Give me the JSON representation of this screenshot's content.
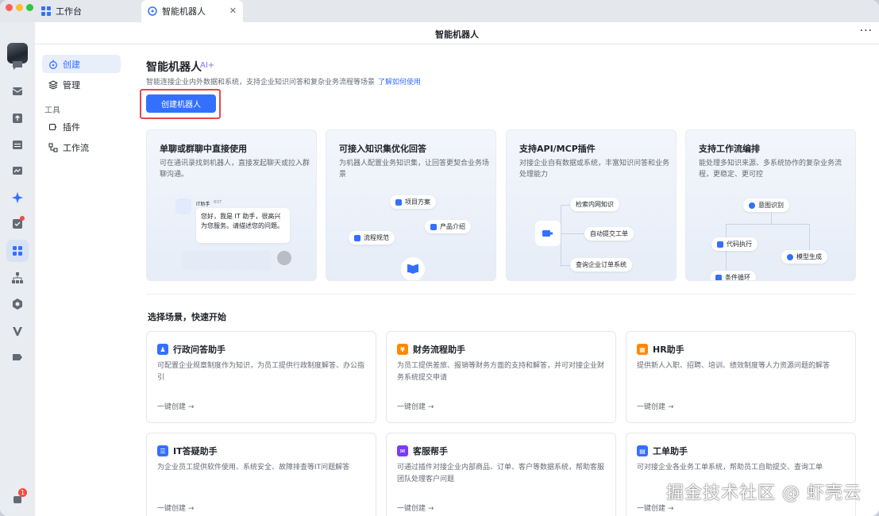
{
  "tabs": [
    {
      "label": "工作台"
    },
    {
      "label": "智能机器人"
    }
  ],
  "header": {
    "title": "智能机器人"
  },
  "subnav": {
    "items": [
      {
        "label": "创建",
        "icon": "bot-icon",
        "active": true
      },
      {
        "label": "管理",
        "icon": "layers-icon"
      }
    ],
    "group_label": "工具",
    "tool_items": [
      {
        "label": "插件",
        "icon": "plugin-icon"
      },
      {
        "label": "工作流",
        "icon": "workflow-icon"
      }
    ]
  },
  "page": {
    "title": "智能机器人",
    "ai_tag": "AI+",
    "description": "智能连接企业内外数据和系统，支持企业知识问答和复杂业务流程等场景",
    "link": "了解如何使用",
    "create_button": "创建机器人"
  },
  "features": [
    {
      "title": "单聊或群聊中直接使用",
      "desc": "可在通讯录找到机器人，直接发起聊天或拉入群聊沟通。",
      "chat_name": "IT助手",
      "chat_tag": "BOT",
      "chat_message": "您好，我是 IT 助手，很高兴为您服务。请描述您的问题。"
    },
    {
      "title": "可接入知识集优化回答",
      "desc": "为机器人配置业务知识集，让回答更契合业务场景",
      "chips": [
        "项目方案",
        "产品介绍",
        "流程规范"
      ]
    },
    {
      "title": "支持API/MCP插件",
      "desc": "对接企业自有数据或系统，丰富知识问答和业务处理能力",
      "chips": [
        "检索内网知识",
        "自动提交工单",
        "查询企业订单系统"
      ]
    },
    {
      "title": "支持工作流编排",
      "desc": "能处理多知识来源、多系统协作的复杂业务流程，更稳定、更可控",
      "chips": [
        "意图识别",
        "代码执行",
        "模型生成",
        "条件循环"
      ]
    }
  ],
  "scenarios": {
    "title": "选择场景，快速开始",
    "cards": [
      {
        "title": "行政问答助手",
        "desc": "可配置企业规章制度作为知识，为员工提供行政制度解答、办公指引",
        "action": "一键创建 →",
        "color": "#3370ff",
        "icon": "person-icon"
      },
      {
        "title": "财务流程助手",
        "desc": "为员工提供差旅、报销等财务方面的支持和解答，并可对接企业财务系统提交申请",
        "action": "一键创建 →",
        "color": "#ff8800",
        "icon": "yen-icon"
      },
      {
        "title": "HR助手",
        "desc": "提供新人入职、招聘、培训、绩效制度等人力资源问题的解答",
        "action": "一键创建 →",
        "color": "#ff8800",
        "icon": "hr-icon"
      },
      {
        "title": "IT答疑助手",
        "desc": "为企业员工提供软件使用、系统安全、故障排查等IT问题解答",
        "action": "一键创建 →",
        "color": "#3370ff",
        "icon": "server-icon"
      },
      {
        "title": "客服帮手",
        "desc": "可通过插件对接企业内部商品、订单、客户等数据系统，帮助客服团队处理客户问题",
        "action": "一键创建 →",
        "color": "#7f3bf5",
        "icon": "chat-icon"
      },
      {
        "title": "工单助手",
        "desc": "可对接企业各业务工单系统，帮助员工自助提交、查询工单",
        "action": "一键创建 →",
        "color": "#3370ff",
        "icon": "ticket-icon"
      }
    ]
  },
  "rail": {
    "badge_count": "1"
  },
  "watermark": "掘金技术社区 @ 虾壳云"
}
